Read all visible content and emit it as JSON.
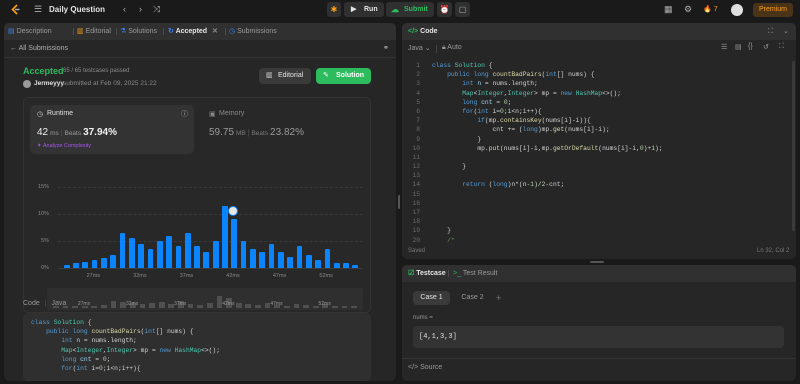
{
  "topbar": {
    "title": "Daily Question",
    "run_label": "Run",
    "submit_label": "Submit",
    "streak": "7",
    "premium_label": "Premium"
  },
  "left_tabs": [
    "Description",
    "Editorial",
    "Solutions",
    "Accepted",
    "Submissions"
  ],
  "subnav": {
    "back_label": "All Submissions"
  },
  "result": {
    "status": "Accepted",
    "testcases": "65 / 65 testcases passed",
    "user": "Jermeyyy",
    "submitted": "submitted at Feb 09, 2025 21:22",
    "editorial_label": "Editorial",
    "solution_label": "Solution"
  },
  "runtime": {
    "label": "Runtime",
    "value": "42",
    "unit": "ms",
    "beats_label": "Beats",
    "beats": "37.94%",
    "analyze_label": "Analyze Complexity"
  },
  "memory": {
    "label": "Memory",
    "value": "59.75",
    "unit": "MB",
    "beats_label": "Beats",
    "beats": "23.82%"
  },
  "chart_data": {
    "type": "bar",
    "ylabel": "",
    "yticks": [
      "15%",
      "10%",
      "5%",
      "0%"
    ],
    "ylim": [
      0,
      15
    ],
    "xticks": [
      "27ms",
      "32ms",
      "37ms",
      "42ms",
      "47ms",
      "52ms"
    ],
    "x": [
      24,
      25,
      26,
      27,
      28,
      29,
      30,
      31,
      32,
      33,
      34,
      35,
      36,
      37,
      38,
      39,
      40,
      41,
      42,
      43,
      44,
      45,
      46,
      47,
      48,
      49,
      50,
      51,
      52,
      53,
      54,
      55
    ],
    "values": [
      0.6,
      1.0,
      1.2,
      1.5,
      1.8,
      2.5,
      6.5,
      5.5,
      4.5,
      3.5,
      5.0,
      6.0,
      4.0,
      6.5,
      4.0,
      3.0,
      5.0,
      11.5,
      9.0,
      5.0,
      3.5,
      3.0,
      4.5,
      3.0,
      2.0,
      4.0,
      2.5,
      1.5,
      3.5,
      1.0,
      1.0,
      0.6
    ],
    "highlight_x": 42
  },
  "overview": {
    "xticks": [
      "27ms",
      "32ms",
      "37ms",
      "42ms",
      "47ms",
      "52ms"
    ]
  },
  "left_code": {
    "header": "Code",
    "lang": "Java",
    "lines": [
      [
        [
          "kw",
          "class "
        ],
        [
          "ty",
          "Solution "
        ],
        [
          "pl",
          "{"
        ]
      ],
      [
        [
          "pl",
          "    "
        ],
        [
          "kw",
          "public long "
        ],
        [
          "fn",
          "countBadPairs"
        ],
        [
          "pl",
          "("
        ],
        [
          "kw",
          "int"
        ],
        [
          "pl",
          "[] nums) {"
        ]
      ],
      [
        [
          "pl",
          "        "
        ],
        [
          "kw",
          "int "
        ],
        [
          "id",
          "n"
        ],
        [
          "pl",
          " = nums.length;"
        ]
      ],
      [
        [
          "pl",
          "        "
        ],
        [
          "ty",
          "Map"
        ],
        [
          "pl",
          "<"
        ],
        [
          "ty",
          "Integer"
        ],
        [
          "pl",
          ","
        ],
        [
          "ty",
          "Integer"
        ],
        [
          "pl",
          "> mp = "
        ],
        [
          "kw",
          "new "
        ],
        [
          "ty",
          "HashMap"
        ],
        [
          "pl",
          "<>();"
        ]
      ],
      [
        [
          "pl",
          "        "
        ],
        [
          "kw",
          "long "
        ],
        [
          "id",
          "cnt"
        ],
        [
          "pl",
          " = "
        ],
        [
          "nm",
          "0"
        ],
        [
          "pl",
          ";"
        ]
      ],
      [
        [
          "pl",
          "        "
        ],
        [
          "kw",
          "for"
        ],
        [
          "pl",
          "("
        ],
        [
          "kw",
          "int "
        ],
        [
          "pl",
          "i="
        ],
        [
          "nm",
          "0"
        ],
        [
          "pl",
          ";i<n;i++){"
        ]
      ]
    ]
  },
  "editor": {
    "header": "Code",
    "lang": "Java",
    "mode": "Auto",
    "saved_label": "Saved",
    "cursor": "Ln 32, Col 2",
    "line_numbers": [
      "1",
      "2",
      "3",
      "4",
      "5",
      "6",
      "7",
      "8",
      "9",
      "10",
      "11",
      "12",
      "13",
      "14",
      "15",
      "16",
      "17",
      "18",
      "19",
      "20"
    ],
    "lines": [
      [
        [
          "kw",
          "class "
        ],
        [
          "ty",
          "Solution "
        ],
        [
          "pl",
          "{"
        ]
      ],
      [
        [
          "pl",
          "    "
        ],
        [
          "kw",
          "public long "
        ],
        [
          "fn",
          "countBadPairs"
        ],
        [
          "pl",
          "("
        ],
        [
          "kw",
          "int"
        ],
        [
          "pl",
          "[] nums) {"
        ]
      ],
      [
        [
          "pl",
          "        "
        ],
        [
          "kw",
          "int "
        ],
        [
          "id",
          "n"
        ],
        [
          "pl",
          " = nums.length;"
        ]
      ],
      [
        [
          "pl",
          "        "
        ],
        [
          "ty",
          "Map"
        ],
        [
          "pl",
          "<"
        ],
        [
          "ty",
          "Integer"
        ],
        [
          "pl",
          ","
        ],
        [
          "ty",
          "Integer"
        ],
        [
          "pl",
          "> mp = "
        ],
        [
          "kw",
          "new "
        ],
        [
          "ty",
          "HashMap"
        ],
        [
          "pl",
          "<>();"
        ]
      ],
      [
        [
          "pl",
          "        "
        ],
        [
          "kw",
          "long "
        ],
        [
          "id",
          "cnt"
        ],
        [
          "pl",
          " = "
        ],
        [
          "nm",
          "0"
        ],
        [
          "pl",
          ";"
        ]
      ],
      [
        [
          "pl",
          "        "
        ],
        [
          "kw",
          "for"
        ],
        [
          "pl",
          "("
        ],
        [
          "kw",
          "int "
        ],
        [
          "pl",
          "i="
        ],
        [
          "nm",
          "0"
        ],
        [
          "pl",
          ";i<n;i++){"
        ]
      ],
      [
        [
          "pl",
          "            "
        ],
        [
          "kw",
          "if"
        ],
        [
          "pl",
          "(mp."
        ],
        [
          "fn",
          "containsKey"
        ],
        [
          "pl",
          "(nums[i]-i)){"
        ]
      ],
      [
        [
          "pl",
          "                cnt += ("
        ],
        [
          "kw",
          "long"
        ],
        [
          "pl",
          ")mp."
        ],
        [
          "fn",
          "get"
        ],
        [
          "pl",
          "(nums[i]-i);"
        ]
      ],
      [
        [
          "pl",
          "            }"
        ]
      ],
      [
        [
          "pl",
          "            mp."
        ],
        [
          "fn",
          "put"
        ],
        [
          "pl",
          "(nums[i]-i,mp."
        ],
        [
          "fn",
          "getOrDefault"
        ],
        [
          "pl",
          "(nums[i]-i,"
        ],
        [
          "nm",
          "0"
        ],
        [
          "pl",
          ")+"
        ],
        [
          "nm",
          "1"
        ],
        [
          "pl",
          ");"
        ]
      ],
      [
        [
          "pl",
          ""
        ]
      ],
      [
        [
          "pl",
          "        }"
        ]
      ],
      [
        [
          "pl",
          ""
        ]
      ],
      [
        [
          "pl",
          "        "
        ],
        [
          "kw",
          "return "
        ],
        [
          "pl",
          "("
        ],
        [
          "kw",
          "long"
        ],
        [
          "pl",
          ")n*(n-"
        ],
        [
          "nm",
          "1"
        ],
        [
          "pl",
          ")/"
        ],
        [
          "nm",
          "2"
        ],
        [
          "pl",
          "-cnt;"
        ]
      ],
      [
        [
          "pl",
          ""
        ]
      ],
      [
        [
          "pl",
          ""
        ]
      ],
      [
        [
          "pl",
          ""
        ]
      ],
      [
        [
          "pl",
          ""
        ]
      ],
      [
        [
          "pl",
          "    }"
        ]
      ],
      [
        [
          "cm",
          "    /*"
        ]
      ]
    ]
  },
  "testcase": {
    "tab_label": "Testcase",
    "result_label": "Test Result",
    "cases": [
      "Case 1",
      "Case 2"
    ],
    "add_label": "+",
    "param_label": "nums =",
    "param_value": "[4,1,3,3]",
    "source_label": "Source"
  }
}
